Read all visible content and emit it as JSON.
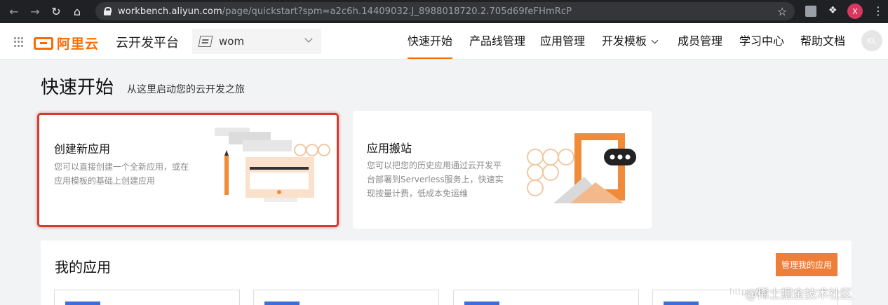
{
  "browser": {
    "url_host": "workbench.aliyun.com",
    "url_rest": "/page/quickstart?spm=a2c6h.14409032.J_8988018720.2.705d69feFHmRcP",
    "profile_initial": "X"
  },
  "header": {
    "logo_text": "阿里云",
    "platform_title": "云开发平台",
    "workspace": "wom",
    "nav": [
      {
        "label": "快速开始",
        "active": true
      },
      {
        "label": "产品线管理"
      },
      {
        "label": "应用管理"
      },
      {
        "label": "开发模板",
        "dropdown": true
      },
      {
        "label": "成员管理"
      },
      {
        "label": "学习中心"
      },
      {
        "label": "帮助文档"
      }
    ],
    "avatar_initials": "KL"
  },
  "page": {
    "title": "快速开始",
    "subtitle": "从这里启动您的云开发之旅"
  },
  "cards": {
    "create": {
      "title": "创建新应用",
      "desc_line1": "您可以直接创建一个全新应用，或在",
      "desc_line2": "应用模板的基础上创建应用"
    },
    "migrate": {
      "title": "应用搬站",
      "desc_line1": "您可以把您的历史应用通过云开发平",
      "desc_line2": "台部署到Serverless服务上，快速实",
      "desc_line3": "现按量计费，低成本免运维"
    }
  },
  "my_apps": {
    "title": "我的应用",
    "manage_label": "管理我的应用"
  },
  "watermark": {
    "faint": "https://bl",
    "text": "@稀土掘金技术社区"
  },
  "colors": {
    "accent": "#ff6a00",
    "button": "#ef7f38",
    "highlight_border": "#d43c30"
  }
}
